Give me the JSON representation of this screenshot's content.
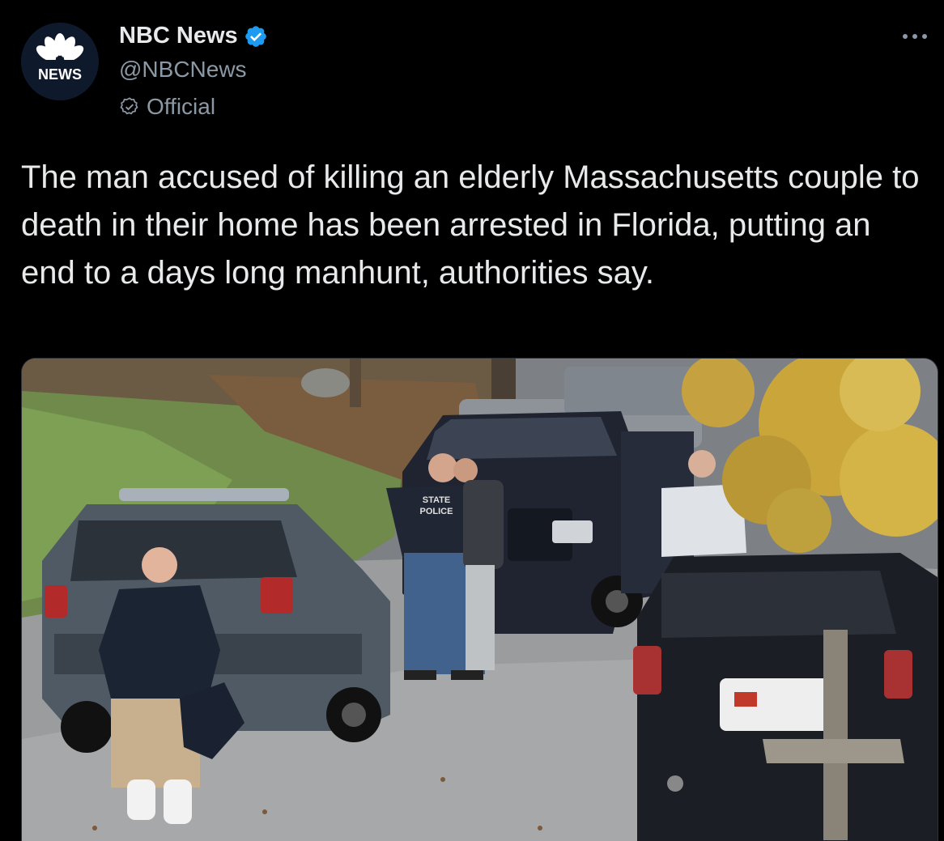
{
  "author": {
    "display_name": "NBC News",
    "handle": "@NBCNews",
    "label": "Official",
    "avatar_text": "NEWS",
    "avatar_icon": "nbc-peacock-logo",
    "verified_icon": "verified-badge-icon",
    "label_icon": "official-check-icon"
  },
  "tweet": {
    "text": "The man accused of killing an elderly Massachusetts couple to death in their home has been arrested in Florida, putting an end to a days long manhunt, authorities say."
  },
  "media": {
    "jacket_text_line1": "STATE",
    "jacket_text_line2": "POLICE"
  },
  "menu": {
    "more_icon": "more-options-icon"
  },
  "colors": {
    "background": "#000000",
    "text": "#e7e9ea",
    "secondary": "#8b98a5",
    "verified": "#1d9bf0"
  }
}
